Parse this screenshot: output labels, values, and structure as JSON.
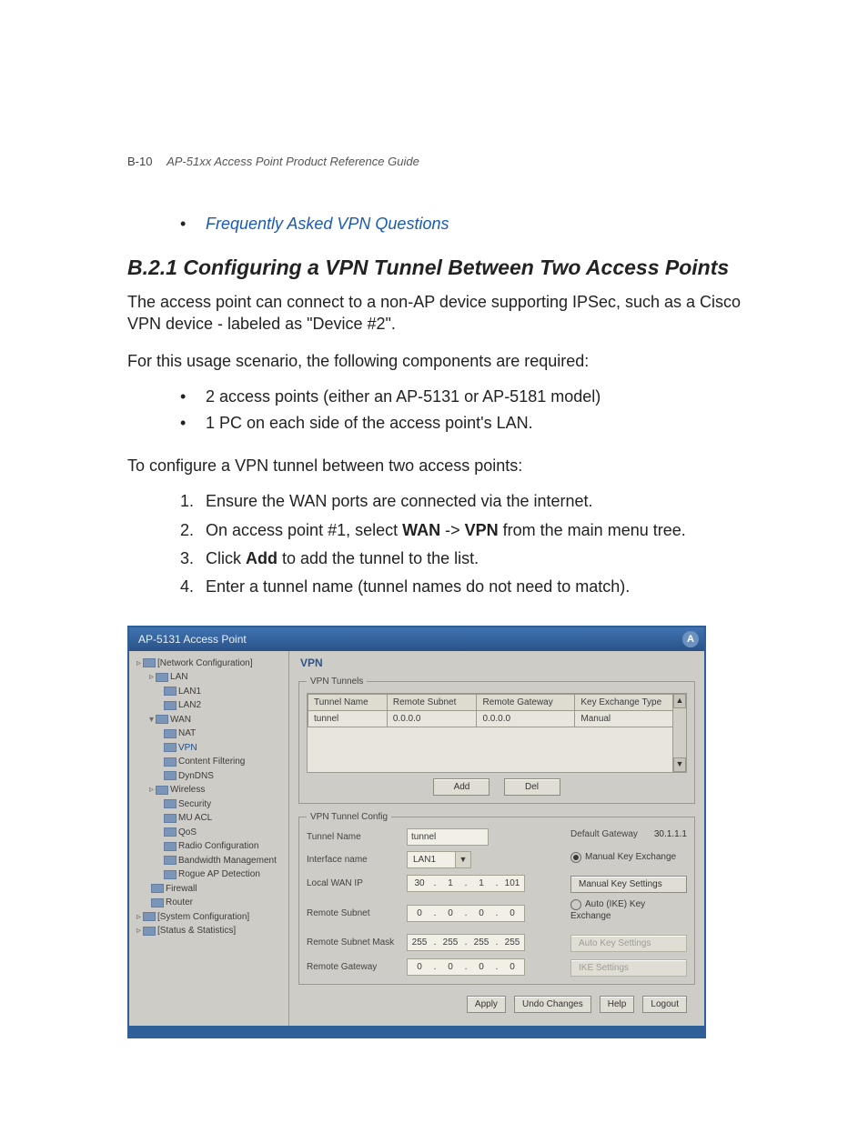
{
  "header": {
    "page_label": "B-10",
    "doc_title": "AP-51xx Access Point Product Reference Guide"
  },
  "intro_bullets": [
    "Frequently Asked VPN Questions"
  ],
  "section": {
    "number": "B.2.1",
    "title": "Configuring a VPN Tunnel Between Two Access Points",
    "p1": "The access point can connect to a non-AP device supporting IPSec, such as a Cisco VPN device - labeled as \"Device #2\".",
    "p2": "For this usage scenario, the following components are required:",
    "req_bullets": [
      "2 access points (either an AP-5131 or AP-5181 model)",
      "1 PC on each side of the access point's LAN."
    ],
    "p3": "To configure a VPN tunnel between two access points:",
    "steps": [
      {
        "full": "Ensure the WAN ports are connected via the internet."
      },
      {
        "pre": "On access point #1, select ",
        "b1": "WAN",
        "mid": " -> ",
        "b2": "VPN",
        "post": " from the main menu tree."
      },
      {
        "pre": "Click ",
        "b1": "Add",
        "post": " to add the tunnel to the list."
      },
      {
        "full": "Enter a tunnel name (tunnel names do not need to match)."
      }
    ]
  },
  "shot": {
    "title": "AP-5131 Access Point",
    "logo_char": "A",
    "tree": [
      {
        "lvl": 1,
        "twist": "▹",
        "label": "[Network Configuration]"
      },
      {
        "lvl": 2,
        "twist": "▹",
        "label": "LAN"
      },
      {
        "lvl": 3,
        "twist": "",
        "label": "LAN1"
      },
      {
        "lvl": 3,
        "twist": "",
        "label": "LAN2"
      },
      {
        "lvl": 2,
        "twist": "▾",
        "label": "WAN"
      },
      {
        "lvl": 3,
        "twist": "",
        "label": "NAT"
      },
      {
        "lvl": 3,
        "twist": "",
        "label": "VPN",
        "selected": true
      },
      {
        "lvl": 3,
        "twist": "",
        "label": "Content Filtering"
      },
      {
        "lvl": 3,
        "twist": "",
        "label": "DynDNS"
      },
      {
        "lvl": 2,
        "twist": "▹",
        "label": "Wireless"
      },
      {
        "lvl": 3,
        "twist": "",
        "label": "Security"
      },
      {
        "lvl": 3,
        "twist": "",
        "label": "MU ACL"
      },
      {
        "lvl": 3,
        "twist": "",
        "label": "QoS"
      },
      {
        "lvl": 3,
        "twist": "",
        "label": "Radio Configuration"
      },
      {
        "lvl": 3,
        "twist": "",
        "label": "Bandwidth Management"
      },
      {
        "lvl": 3,
        "twist": "",
        "label": "Rogue AP Detection"
      },
      {
        "lvl": 2,
        "twist": "",
        "label": "Firewall"
      },
      {
        "lvl": 2,
        "twist": "",
        "label": "Router"
      },
      {
        "lvl": 1,
        "twist": "▹",
        "label": "[System Configuration]"
      },
      {
        "lvl": 1,
        "twist": "▹",
        "label": "[Status & Statistics]"
      }
    ],
    "panel_title": "VPN",
    "group1_title": "VPN Tunnels",
    "table": {
      "headers": [
        "Tunnel Name",
        "Remote Subnet",
        "Remote Gateway",
        "Key Exchange Type"
      ],
      "rows": [
        [
          "tunnel",
          "0.0.0.0",
          "0.0.0.0",
          "Manual"
        ]
      ]
    },
    "buttons": {
      "add": "Add",
      "del": "Del"
    },
    "group2_title": "VPN Tunnel Config",
    "cfg": {
      "tunnel_name_label": "Tunnel Name",
      "tunnel_name_value": "tunnel",
      "interface_label": "Interface name",
      "interface_value": "LAN1",
      "local_wan_label": "Local WAN IP",
      "local_wan_ip": [
        "30",
        "1",
        "1",
        "101"
      ],
      "remote_subnet_label": "Remote Subnet",
      "remote_subnet_ip": [
        "0",
        "0",
        "0",
        "0"
      ],
      "remote_mask_label": "Remote Subnet Mask",
      "remote_mask_ip": [
        "255",
        "255",
        "255",
        "255"
      ],
      "remote_gw_label": "Remote Gateway",
      "remote_gw_ip": [
        "0",
        "0",
        "0",
        "0"
      ],
      "default_gw_label": "Default Gateway",
      "default_gw_value": "30.1.1.1",
      "manual_radio": "Manual Key Exchange",
      "manual_btn": "Manual Key Settings",
      "auto_radio": "Auto (IKE) Key Exchange",
      "auto_btn": "Auto Key Settings",
      "ike_btn": "IKE Settings"
    },
    "bottom": {
      "apply": "Apply",
      "undo": "Undo Changes",
      "help": "Help",
      "logout": "Logout"
    }
  }
}
